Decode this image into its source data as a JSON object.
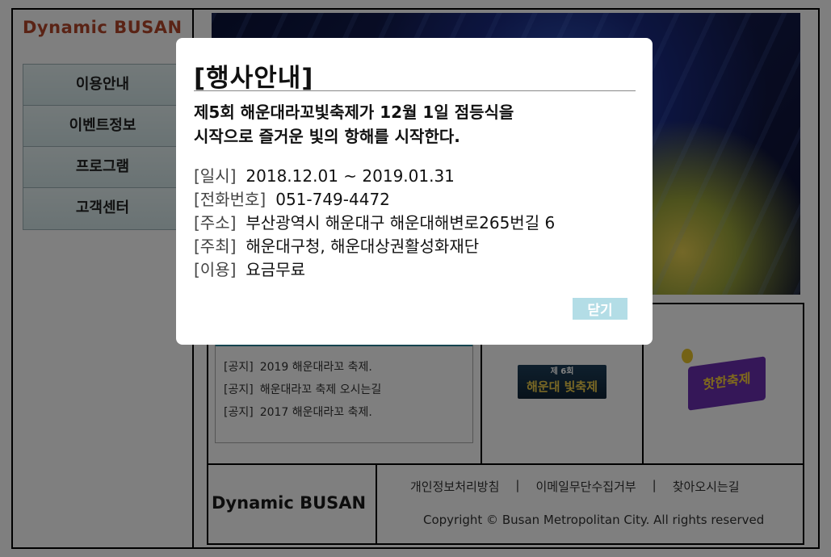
{
  "site": {
    "logo": "Dynamic BUSAN",
    "menu": [
      {
        "label": "이용안내"
      },
      {
        "label": "이벤트정보"
      },
      {
        "label": "프로그램"
      },
      {
        "label": "고객센터"
      }
    ]
  },
  "notices": [
    {
      "tag": "[공지]",
      "text": "2019 해운대라꼬 축제."
    },
    {
      "tag": "[공지]",
      "text": "해운대라꼬 축제 오시는길"
    },
    {
      "tag": "[공지]",
      "text": "2017 해운대라꼬 축제."
    }
  ],
  "thumbnails": {
    "thumb1": {
      "small": "제 6회",
      "big": "해운대 빛축제"
    },
    "thumb2": {
      "prefix": "",
      "highlight": "핫한축제"
    }
  },
  "footer": {
    "logo": "Dynamic BUSAN",
    "links": [
      "개인정보처리방침",
      "이메일무단수집거부",
      "찾아오시는길"
    ],
    "separator": "|",
    "copyright": "Copyright © Busan Metropolitan City. All rights reserved"
  },
  "modal": {
    "title": "[행사안내]",
    "headline_line1": "제5회 해운대라꼬빛축제가 12월 1일 점등식을",
    "headline_line2": "시작으로 즐거운 빛의 항해를 시작한다.",
    "info": [
      {
        "label": "[일시]",
        "value": "2018.12.01 ~ 2019.01.31"
      },
      {
        "label": "[전화번호]",
        "value": "051-749-4472"
      },
      {
        "label": "[주소]",
        "value": "부산광역시 해운대구 해운대해변로265번길 6"
      },
      {
        "label": "[주최]",
        "value": "해운대구청, 해운대상권활성화재단"
      },
      {
        "label": "[이용]",
        "value": "요금무료"
      }
    ],
    "close_label": "닫기"
  },
  "colors": {
    "logo": "#b5462a",
    "close_button": "#b3dde6",
    "overlay": "rgba(0,0,0,0.5)"
  }
}
